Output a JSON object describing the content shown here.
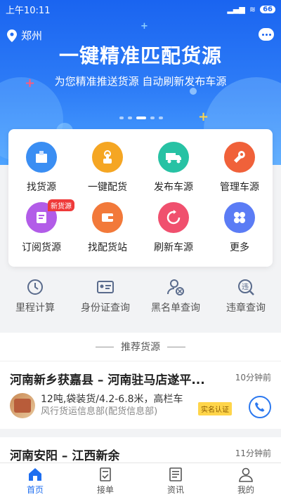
{
  "status": {
    "time": "上午10:11",
    "battery": "66"
  },
  "header": {
    "city": "郑州"
  },
  "banner": {
    "headline": "一键精准匹配货源",
    "subline": "为您精准推送货源 自动刷新发布车源"
  },
  "features": [
    {
      "label": "找货源",
      "icon": "box-icon",
      "color": "#3a8ef3"
    },
    {
      "label": "一键配货",
      "icon": "tap-finger-icon",
      "color": "#f5a623"
    },
    {
      "label": "发布车源",
      "icon": "truck-icon",
      "color": "#27c2a4"
    },
    {
      "label": "管理车源",
      "icon": "wrench-icon",
      "color": "#f0613a"
    },
    {
      "label": "订阅货源",
      "icon": "subscribe-icon",
      "color": "#b25ce8",
      "tag": "新货源"
    },
    {
      "label": "找配货站",
      "icon": "wallet-icon",
      "color": "#f2793a"
    },
    {
      "label": "刷新车源",
      "icon": "refresh-icon",
      "color": "#f0506e"
    },
    {
      "label": "更多",
      "icon": "grid-icon",
      "color": "#5b7cf5"
    }
  ],
  "tools": [
    {
      "label": "里程计算",
      "icon": "clock-icon"
    },
    {
      "label": "身份证查询",
      "icon": "id-card-icon"
    },
    {
      "label": "黑名单查询",
      "icon": "blacklist-user-icon"
    },
    {
      "label": "违章查询",
      "icon": "violation-icon"
    }
  ],
  "recommend": {
    "title": "推荐货源",
    "items": [
      {
        "route": "河南新乡获嘉县 – 河南驻马店遂平...",
        "time": "10分钟前",
        "spec": "12吨,袋装货/4.2-6.8米，高栏车",
        "company": "风行货运信息部(配货信息部)",
        "badge": "实名认证"
      },
      {
        "route": "河南安阳 – 江西新余",
        "time": "11分钟前"
      }
    ]
  },
  "tabs": [
    {
      "label": "首页",
      "icon": "home-icon",
      "active": true
    },
    {
      "label": "接单",
      "icon": "order-icon"
    },
    {
      "label": "资讯",
      "icon": "news-icon"
    },
    {
      "label": "我的",
      "icon": "profile-icon"
    }
  ]
}
